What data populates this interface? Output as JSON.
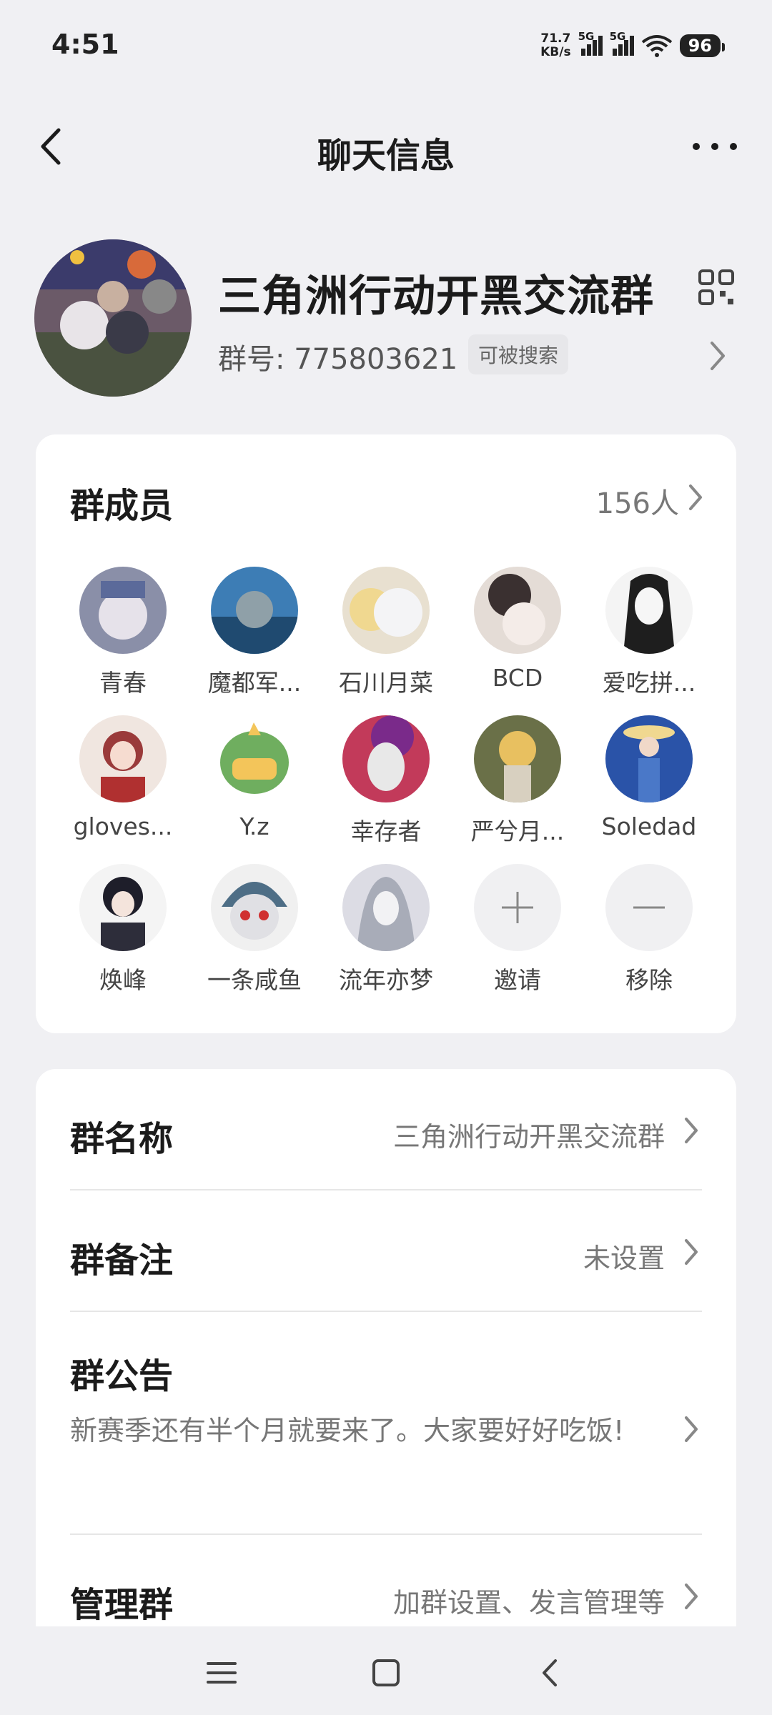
{
  "status_bar": {
    "time": "4:51",
    "net_speed_value": "71.7",
    "net_speed_unit": "KB/s",
    "signal1_label": "5G",
    "signal2_label": "5G",
    "battery": "96"
  },
  "header": {
    "title": "聊天信息"
  },
  "group": {
    "name": "三角洲行动开黑交流群",
    "id_text": "群号: 775803621",
    "searchable_badge": "可被搜索"
  },
  "members": {
    "title": "群成员",
    "count": "156人",
    "list": [
      {
        "name": "青春",
        "color": "#8a8fa8"
      },
      {
        "name": "魔都军...",
        "color": "#3d7db5"
      },
      {
        "name": "石川月菜",
        "color": "#d8c8b0"
      },
      {
        "name": "BCD",
        "color": "#c9b9b0"
      },
      {
        "name": "爱吃拼...",
        "color": "#3a3a3a"
      },
      {
        "name": "gloves...",
        "color": "#b04a48"
      },
      {
        "name": "Y.z",
        "color": "#6fae5f"
      },
      {
        "name": "幸存者",
        "color": "#c23a5a"
      },
      {
        "name": "严兮月...",
        "color": "#6a7048"
      },
      {
        "name": "Soledad",
        "color": "#2a53a8"
      },
      {
        "name": "焕峰",
        "color": "#2d2d3a"
      },
      {
        "name": "一条咸鱼",
        "color": "#4e6e86"
      },
      {
        "name": "流年亦梦",
        "color": "#a8acb8"
      }
    ],
    "invite_label": "邀请",
    "remove_label": "移除"
  },
  "settings": {
    "group_name_label": "群名称",
    "group_name_value": "三角洲行动开黑交流群",
    "group_remark_label": "群备注",
    "group_remark_value": "未设置",
    "announcement_label": "群公告",
    "announcement_text": "新赛季还有半个月就要来了。大家要好好吃饭!",
    "manage_label": "管理群",
    "manage_value": "加群设置、发言管理等"
  },
  "colors": {
    "background": "#f0f0f3",
    "card": "#ffffff",
    "primary_text": "#1b1b1b",
    "secondary_text": "#777777"
  }
}
